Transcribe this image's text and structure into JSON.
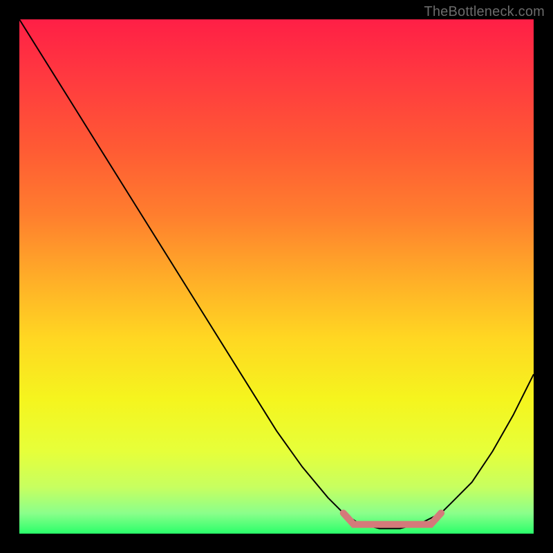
{
  "watermark": "TheBottleneck.com",
  "chart_data": {
    "type": "line",
    "title": "",
    "xlabel": "",
    "ylabel": "",
    "xlim": [
      0,
      100
    ],
    "ylim": [
      0,
      100
    ],
    "grid": false,
    "background_gradient": {
      "stops": [
        {
          "offset": 0.0,
          "color": "#ff1f46"
        },
        {
          "offset": 0.12,
          "color": "#ff3b3f"
        },
        {
          "offset": 0.25,
          "color": "#ff5a34"
        },
        {
          "offset": 0.38,
          "color": "#ff7e2e"
        },
        {
          "offset": 0.5,
          "color": "#ffac28"
        },
        {
          "offset": 0.62,
          "color": "#ffd722"
        },
        {
          "offset": 0.74,
          "color": "#f5f51e"
        },
        {
          "offset": 0.84,
          "color": "#e6ff3a"
        },
        {
          "offset": 0.91,
          "color": "#c7ff60"
        },
        {
          "offset": 0.96,
          "color": "#8bff8b"
        },
        {
          "offset": 1.0,
          "color": "#2aff6a"
        }
      ]
    },
    "series": [
      {
        "name": "bottleneck-curve",
        "stroke": "#000000",
        "stroke_width": 2,
        "x": [
          0,
          5,
          10,
          15,
          20,
          25,
          30,
          35,
          40,
          45,
          50,
          55,
          60,
          63,
          66,
          70,
          74,
          78,
          82,
          84,
          88,
          92,
          96,
          100
        ],
        "y": [
          100,
          92,
          84,
          76,
          68,
          60,
          52,
          44,
          36,
          28,
          20,
          13,
          7,
          4,
          2,
          1,
          1,
          2,
          4,
          6,
          10,
          16,
          23,
          31
        ]
      }
    ],
    "highlight_band": {
      "name": "optimal-range",
      "color": "#d47a7a",
      "stroke_width": 10,
      "x_start": 63,
      "x_end": 82,
      "y_at_start": 4,
      "y_flat": 1.8,
      "y_at_end": 4
    }
  }
}
